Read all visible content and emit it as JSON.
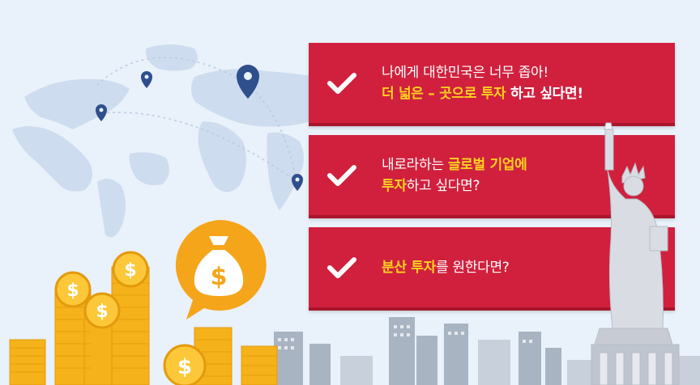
{
  "cards": [
    {
      "line1": "나에게 대한민국은 너무 좁아!",
      "line2_a": "더 넓은 – 곳으로 투자",
      "line2_b": " 하고 싶다면!"
    },
    {
      "line1_a": "내로라하는 ",
      "line1_b": "글로벌 기업에",
      "line2_a": "투자",
      "line2_b": "하고 싶다면?"
    },
    {
      "line1_a": "분산 투자",
      "line1_b": "를 원한다면?"
    }
  ],
  "money_symbol": "$",
  "colors": {
    "card": "#d0203d",
    "highlight": "#ffd21f",
    "background": "#e9f1fa",
    "coin": "#f5b21a",
    "pin": "#2f4e8c"
  },
  "icons": [
    "check-icon",
    "map-pin-icon",
    "money-bag-icon",
    "dollar-coin-icon",
    "statue-of-liberty-icon",
    "city-skyline"
  ]
}
